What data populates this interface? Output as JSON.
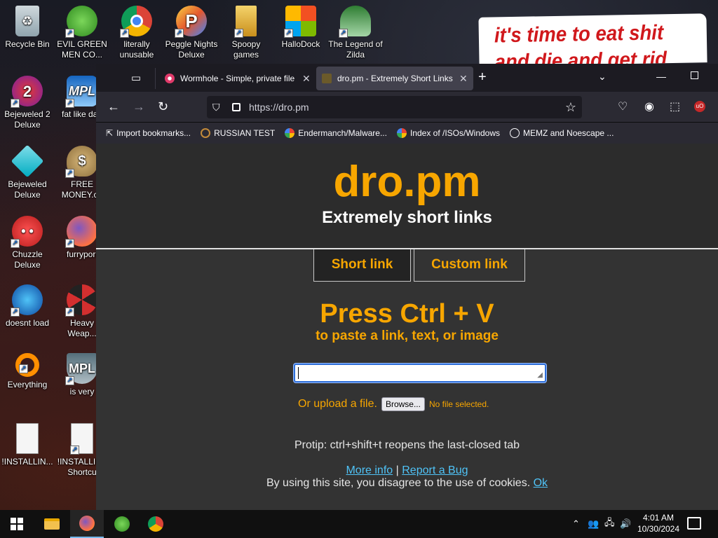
{
  "desktop": {
    "meme_text_line1": "it's time to eat shit",
    "meme_text_line2": "and die and get rid",
    "icons": [
      {
        "label": "Recycle Bin"
      },
      {
        "label": "EVIL GREEN MEN CO..."
      },
      {
        "label": "literally unusable"
      },
      {
        "label": "Peggle Nights Deluxe"
      },
      {
        "label": "Spoopy games"
      },
      {
        "label": "HalloDock"
      },
      {
        "label": "The Legend of Zilda"
      },
      {
        "label": "Bejeweled 2 Deluxe"
      },
      {
        "label": "fat like darl"
      },
      {
        "label": "Bejeweled Deluxe"
      },
      {
        "label": "FREE MONEY.co"
      },
      {
        "label": "Chuzzle Deluxe"
      },
      {
        "label": "furrypori"
      },
      {
        "label": "doesnt load"
      },
      {
        "label": "Heavy Weap..."
      },
      {
        "label": "Everything"
      },
      {
        "label": "is very"
      },
      {
        "label": "!INSTALLIN..."
      },
      {
        "label": "!INSTALLIN - Shortcu"
      }
    ]
  },
  "browser": {
    "tabs": [
      {
        "title": "Wormhole - Simple, private file",
        "active": false,
        "favicon_color": "#e03a6a"
      },
      {
        "title": "dro.pm - Extremely Short Links",
        "active": true,
        "favicon_color": "#6b5a2a"
      }
    ],
    "new_tab_icon": "plus-icon",
    "url": "https://dro.pm",
    "bookmarks": [
      {
        "label": "Import bookmarks...",
        "icon": "import-icon"
      },
      {
        "label": "RUSSIAN TEST",
        "icon": "search-icon"
      },
      {
        "label": "Endermanch/Malware...",
        "icon": "google-icon"
      },
      {
        "label": "Index of /ISOs/Windows",
        "icon": "google-icon"
      },
      {
        "label": "MEMZ and Noescape ...",
        "icon": "globe-icon"
      }
    ]
  },
  "page": {
    "logo": "dro.pm",
    "tagline": "Extremely short links",
    "tab_short": "Short link",
    "tab_custom": "Custom link",
    "press_title": "Press Ctrl + V",
    "press_sub": "to paste a link, text, or image",
    "paste_value": "",
    "upload_label": "Or upload a file.",
    "browse_button": "Browse...",
    "no_file": "No file selected.",
    "protip": "Protip: ctrl+shift+t reopens the last-closed tab",
    "more_info": "More info",
    "separator": "|",
    "report_bug": "Report a Bug",
    "cookie_text": "By using this site, you disagree to the use of cookies.",
    "cookie_ok": "Ok"
  },
  "taskbar": {
    "time": "4:01 AM",
    "date": "10/30/2024"
  },
  "colors": {
    "accent_orange": "#f7a600",
    "link_blue": "#4fc3f7",
    "page_bg": "#333333"
  }
}
